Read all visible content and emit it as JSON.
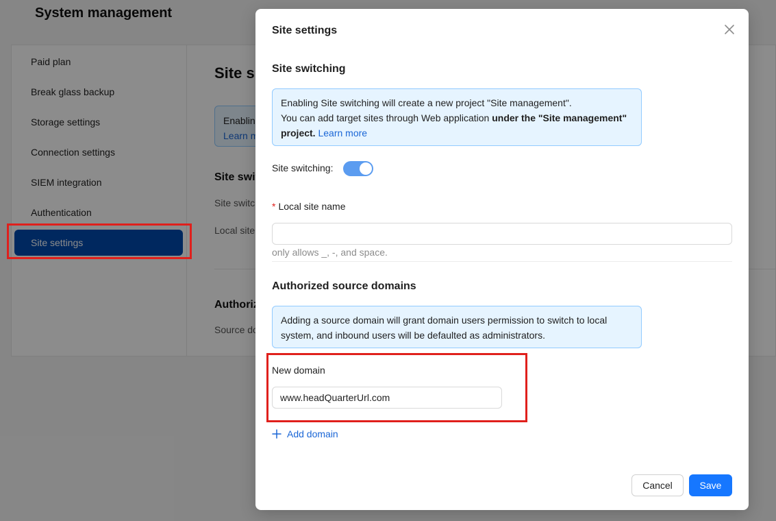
{
  "page": {
    "title": "System management",
    "sidebar": {
      "items": [
        {
          "label": "Paid plan"
        },
        {
          "label": "Break glass backup"
        },
        {
          "label": "Storage settings"
        },
        {
          "label": "Connection settings"
        },
        {
          "label": "SIEM integration"
        },
        {
          "label": "Authentication"
        },
        {
          "label": "Site settings",
          "active": true
        }
      ]
    },
    "content": {
      "title": "Site s",
      "alert_line1": "Enablin",
      "alert_line2": "Learn m",
      "section1": "Site switc",
      "label1": "Site switc",
      "label2": "Local site",
      "section2": "Authoriz",
      "label3": "Source do"
    }
  },
  "modal": {
    "title": "Site settings",
    "site_switching": {
      "heading": "Site switching",
      "alert_text1": "Enabling Site switching will create a new project \"Site management\".",
      "alert_text2": "You can add target sites through Web application ",
      "alert_bold": "under the \"Site management\" project.",
      "alert_link": "Learn more",
      "toggle_label": "Site switching:",
      "toggle_on": true
    },
    "local_site": {
      "label": "Local site name",
      "required_mark": "*",
      "value": "",
      "hint": "only allows _, -, and space."
    },
    "authorized": {
      "heading": "Authorized source domains",
      "alert_text": "Adding a source domain will grant domain users permission to switch to local system, and inbound users will be defaulted as administrators.",
      "new_domain_label": "New domain",
      "new_domain_value": "www.headQuarterUrl.com",
      "add_domain_label": "Add domain"
    },
    "footer": {
      "cancel_label": "Cancel",
      "save_label": "Save"
    }
  },
  "colors": {
    "primary": "#1677ff",
    "active_nav": "#004aad",
    "highlight": "#e0201c",
    "info_bg": "#e6f4ff",
    "info_border": "#91caff"
  }
}
